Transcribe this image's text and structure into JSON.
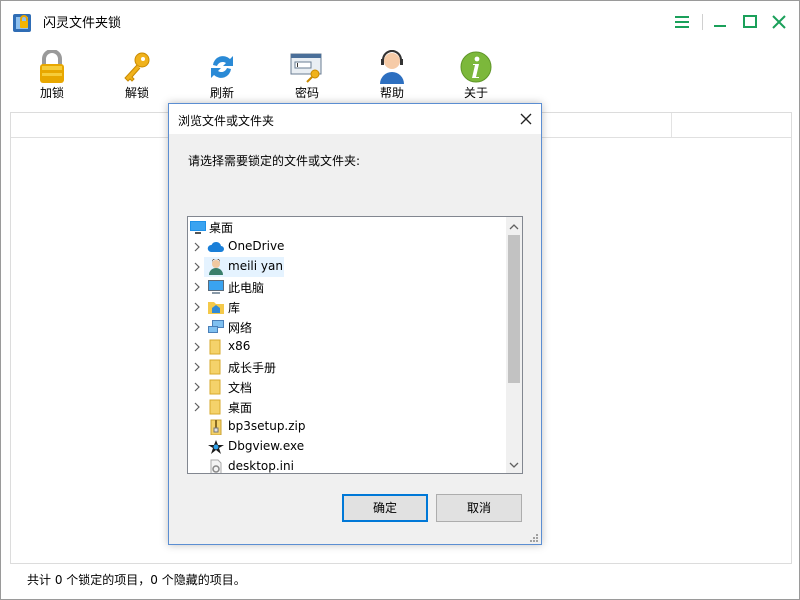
{
  "app": {
    "title": "闪灵文件夹锁",
    "status": "共计 0 个锁定的项目，0 个隐藏的项目。"
  },
  "toolbar": {
    "lock_label": "加锁",
    "unlock_label": "解锁",
    "refresh_label": "刷新",
    "password_label": "密码",
    "help_label": "帮助",
    "about_label": "关于"
  },
  "dialog": {
    "title": "浏览文件或文件夹",
    "prompt": "请选择需要锁定的文件或文件夹:",
    "ok_label": "确定",
    "cancel_label": "取消",
    "tree": [
      {
        "label": "桌面",
        "icon": "desktop-icon"
      },
      {
        "label": "OneDrive",
        "icon": "cloud-icon"
      },
      {
        "label": "meili yan",
        "icon": "user-icon",
        "selected": true
      },
      {
        "label": "此电脑",
        "icon": "computer-icon"
      },
      {
        "label": "库",
        "icon": "library-icon"
      },
      {
        "label": "网络",
        "icon": "network-icon"
      },
      {
        "label": "x86",
        "icon": "folder-icon"
      },
      {
        "label": "成长手册",
        "icon": "folder-icon"
      },
      {
        "label": "文档",
        "icon": "folder-icon"
      },
      {
        "label": "桌面",
        "icon": "folder-icon"
      },
      {
        "label": "bp3setup.zip",
        "icon": "zip-icon"
      },
      {
        "label": "Dbgview.exe",
        "icon": "exe-icon"
      },
      {
        "label": "desktop.ini",
        "icon": "ini-icon"
      }
    ]
  },
  "colors": {
    "accent": "#0078d7",
    "window_control": "#1aa05a",
    "selection": "#e5f3ff"
  }
}
